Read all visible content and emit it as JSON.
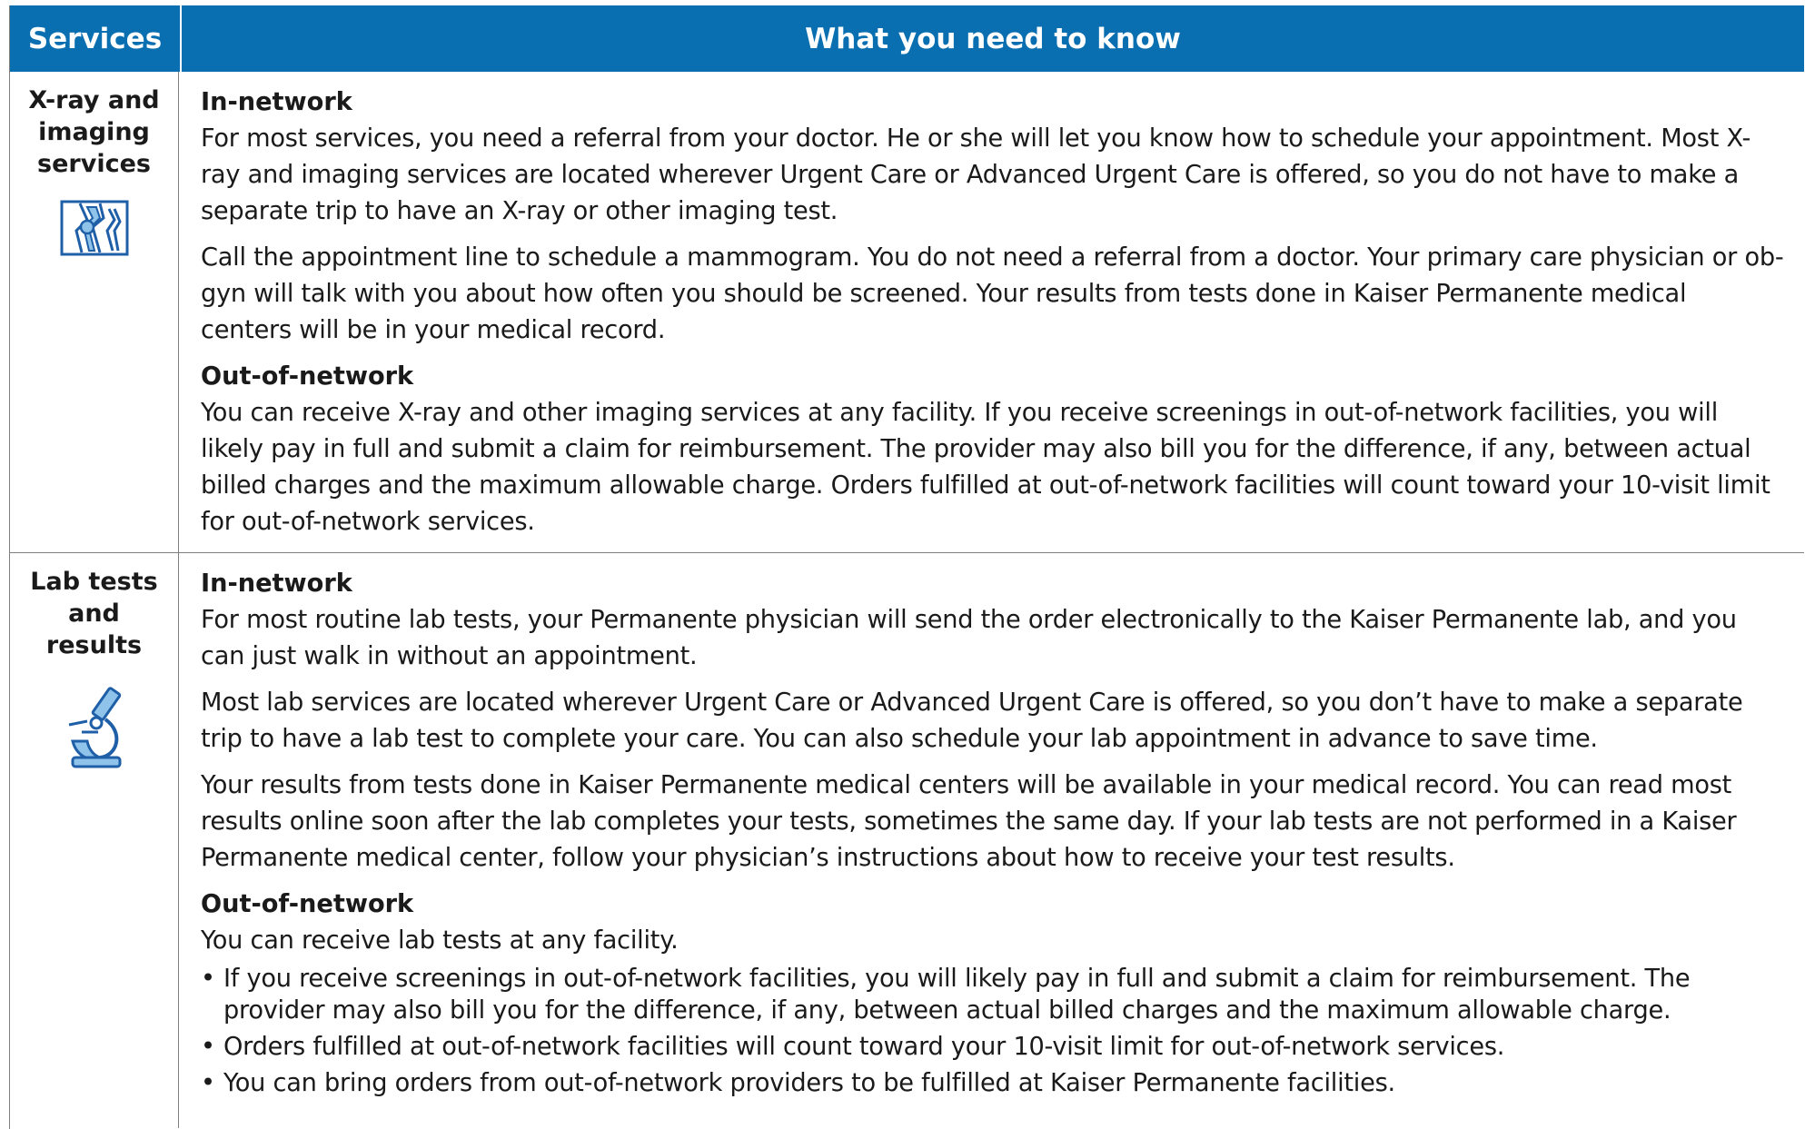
{
  "header": {
    "services": "Services",
    "info": "What you need to know"
  },
  "rows": [
    {
      "service": "X-ray and imaging services",
      "icon": "knee-joint-icon",
      "in_network_heading": "In-network",
      "in_network": [
        "For most services, you need a referral from your doctor. He or she will let you know how to schedule your appointment. Most X-ray and imaging services are located wherever Urgent Care or Advanced Urgent Care is offered, so you do not have to make a separate trip to have an X-ray or other imaging test.",
        "Call the appointment line to schedule a mammogram. You do not need a referral from a doctor. Your primary care physician or ob-gyn will talk with you about how often you should be screened. Your results from tests done in Kaiser Permanente medical centers will be in your medical record."
      ],
      "out_network_heading": "Out-of-network",
      "out_network": [
        "You can receive X-ray and other imaging services at any facility. If you receive screenings in out-of-network facilities, you will likely pay in full and submit a claim for reimbursement. The provider may also bill you for the difference, if any, between actual billed charges and the maximum allowable charge. Orders fulfilled at out-of-network facilities will count toward your 10-visit limit for out-of-network services."
      ]
    },
    {
      "service": "Lab tests and results",
      "icon": "microscope-icon",
      "in_network_heading": "In-network",
      "in_network": [
        "For most routine lab tests, your Permanente physician will send the order electronically to the Kaiser Permanente lab, and you can just walk in without an appointment.",
        "Most lab services are located wherever Urgent Care or Advanced Urgent Care is offered, so you don’t have to make a separate trip to have a lab test to complete your care. You can also schedule your lab appointment in advance to save time.",
        "Your results from tests done in Kaiser Permanente medical centers will be available in your medical record. You can read most results online soon after the lab completes your tests, sometimes the same day. If your lab tests are not performed in a Kaiser Permanente medical center, follow your physician’s instructions about how to receive your test results."
      ],
      "out_network_heading": "Out-of-network",
      "out_network_intro": "You can receive lab tests at any facility.",
      "out_network_bullets": [
        "If you receive screenings in out-of-network facilities, you will likely pay in full and submit a claim for reimbursement. The provider may also bill you for the difference, if any, between actual billed charges and the maximum allowable charge.",
        "Orders fulfilled at out-of-network facilities will count toward your 10-visit limit for out-of-network services.",
        "You can bring orders from out-of-network providers to be fulfilled at Kaiser Permanente facilities."
      ]
    }
  ],
  "colors": {
    "header_bg": "#0a6fb0",
    "icon_stroke": "#1f5fa8",
    "icon_fill": "#8fc3ea"
  }
}
